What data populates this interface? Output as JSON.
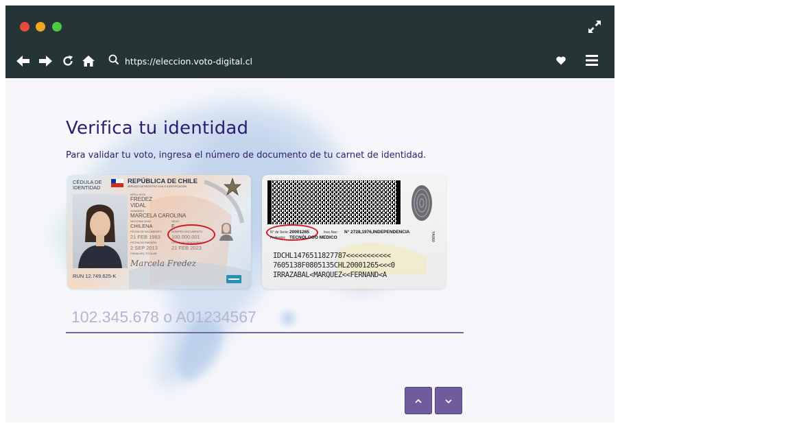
{
  "browser": {
    "url": "https://eleccion.voto-digital.cl",
    "colors": {
      "toolbar": "#253536",
      "close": "#e84a3f",
      "minimize": "#f2a724",
      "maximize": "#4ec83f"
    },
    "icons": [
      "arrow-left-icon",
      "arrow-right-icon",
      "reload-icon",
      "home-icon",
      "search-icon",
      "heart-icon",
      "hamburger-menu-icon",
      "expand-icon"
    ]
  },
  "page": {
    "title": "Verifica tu identidad",
    "subtitle": "Para validar tu voto, ingresa el número de documento de tu carnet de identidad.",
    "accent": "#2c1d6e"
  },
  "card_front": {
    "type_label_1": "CÉDULA DE",
    "type_label_2": "IDENTIDAD",
    "country": "REPÚBLICA DE CHILE",
    "agency": "SERVICIO DE REGISTRO CIVIL E IDENTIFICACIÓN",
    "surname_label": "APELLIDOS",
    "surname_1": "FREDEZ",
    "surname_2": "VIDAL",
    "names_label": "NOMBRES",
    "names": "MARCELA CAROLINA",
    "nationality_label": "NACIONALIDAD",
    "nationality": "CHILENA",
    "sex_label": "SEXO",
    "sex": "F",
    "birth_label": "FECHA DE NACIMIENTO",
    "birth": "21 FEB 1983",
    "docnum_label": "NÚMERO DOCUMENTO",
    "docnum": "100.000.001",
    "issue_label": "FECHA DE EMISIÓN",
    "issue": "2 SEP 2013",
    "expiry_label": "FECHA DE VENCIMIENTO",
    "expiry": "21 FEB 2023",
    "signature_label": "FIRMA DEL TITULAR",
    "signature": "Marcela Fredez",
    "run": "RUN 12.749.625-K"
  },
  "card_back": {
    "serial_label": "N° de Serie:",
    "serial": "20001265",
    "insc_label": "Insc.Nac:",
    "insc": "N° 2728,1976,INDEPENDENCIA",
    "profession_label": "Profesión:",
    "profession": "TECNÓLOGO MEDICO",
    "side_code": "YA060",
    "mrz_1": "IDCHL1476511827787<<<<<<<<<<<",
    "mrz_2": "7605138F0805135CHL20001265<<<0",
    "mrz_3": "IRRAZABAL<MARQUEZ<<FERNAND<A"
  },
  "form": {
    "placeholder": "102.345.678 o A01234567",
    "value": ""
  },
  "pager": {
    "up_icon": "chevron-up-icon",
    "down_icon": "chevron-down-icon",
    "color": "#6e5c9c"
  }
}
